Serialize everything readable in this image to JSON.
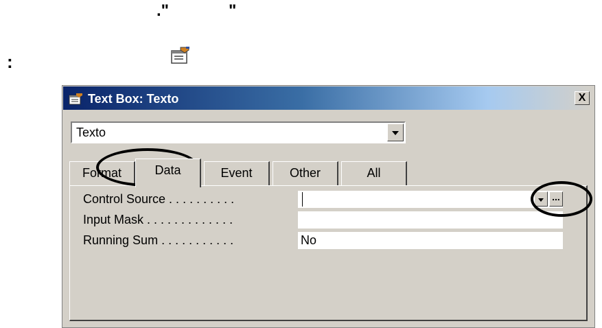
{
  "annotations": {
    "top_marks_left": ".\"",
    "top_marks_right": "\"",
    "colon": ":"
  },
  "window": {
    "title": "Text Box: Texto",
    "close_label": "X",
    "object_selector_value": "Texto",
    "tabs": [
      {
        "label": "Format",
        "active": false
      },
      {
        "label": "Data",
        "active": true
      },
      {
        "label": "Event",
        "active": false
      },
      {
        "label": "Other",
        "active": false
      },
      {
        "label": "All",
        "active": false
      }
    ],
    "properties": [
      {
        "label": "Control Source . . . . . . . . . .",
        "value": ""
      },
      {
        "label": "Input Mask . . . . . . . . . . . . .",
        "value": ""
      },
      {
        "label": "Running Sum . . . . . . . . . . .",
        "value": "No"
      }
    ],
    "builder_button_label": "...",
    "icons": [
      "properties-icon",
      "close-icon",
      "chevron-down-icon",
      "builder-icon"
    ]
  }
}
